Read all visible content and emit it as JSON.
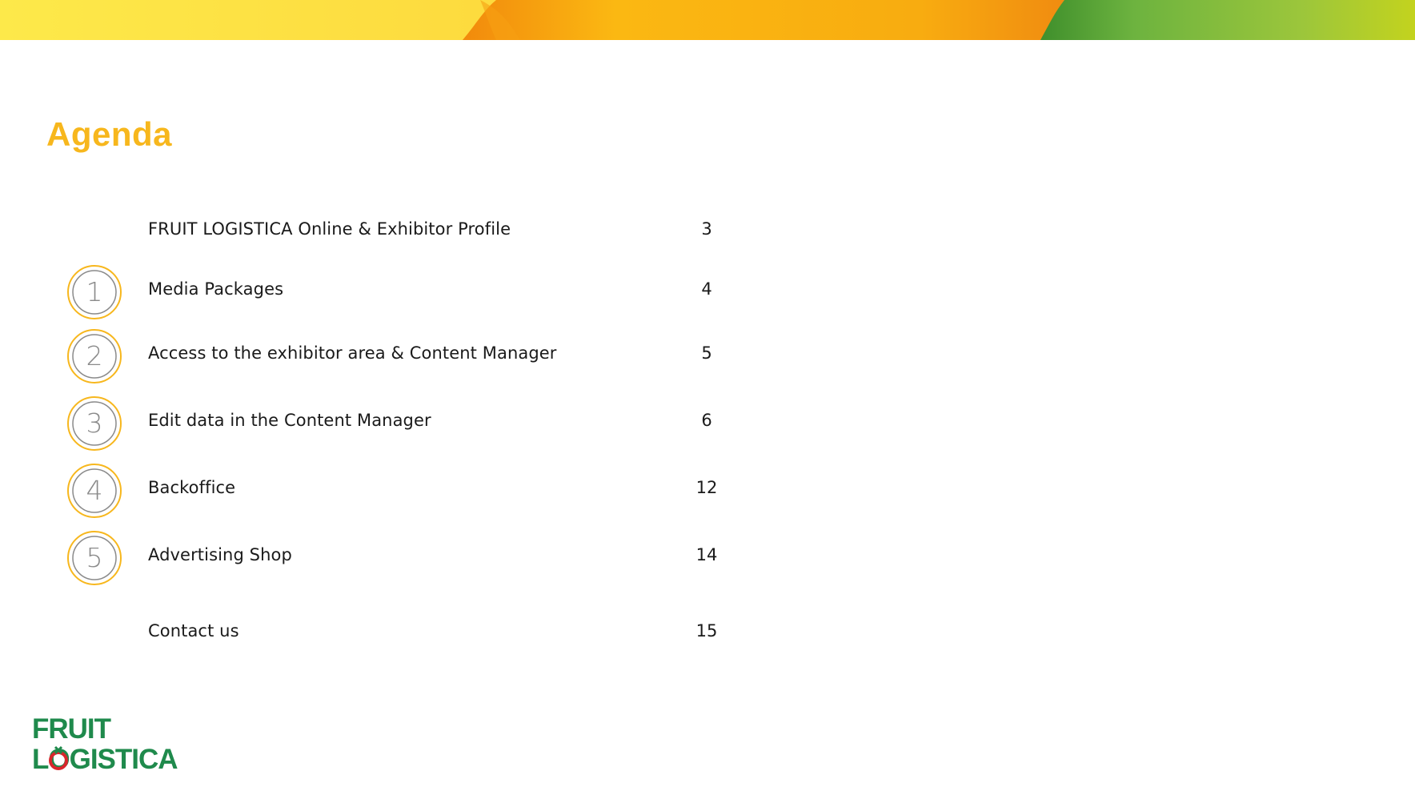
{
  "slide": {
    "title": "Agenda"
  },
  "agenda": {
    "items": [
      {
        "number": "",
        "label": "FRUIT LOGISTICA Online & Exhibitor Profile",
        "page": "3"
      },
      {
        "number": "1",
        "label": "Media Packages",
        "page": "4"
      },
      {
        "number": "2",
        "label": "Access to the exhibitor area & Content Manager",
        "page": "5"
      },
      {
        "number": "3",
        "label": "Edit data in the Content Manager",
        "page": "6"
      },
      {
        "number": "4",
        "label": "Backoffice",
        "page": "12"
      },
      {
        "number": "5",
        "label": "Advertising Shop",
        "page": "14"
      },
      {
        "number": "",
        "label": "Contact us",
        "page": "15"
      }
    ]
  },
  "logo": {
    "line1": "FRUIT",
    "line2": "LOGISTICA"
  },
  "colors": {
    "title": "#f7b71d",
    "circle_ring": "#f7b71d",
    "circle_inner": "#8a8a8a",
    "text": "#1a1a1a",
    "logo_green": "#1f8a4c",
    "logo_red": "#d9262c"
  },
  "icons": {
    "circle": "numbered-circle-icon"
  }
}
